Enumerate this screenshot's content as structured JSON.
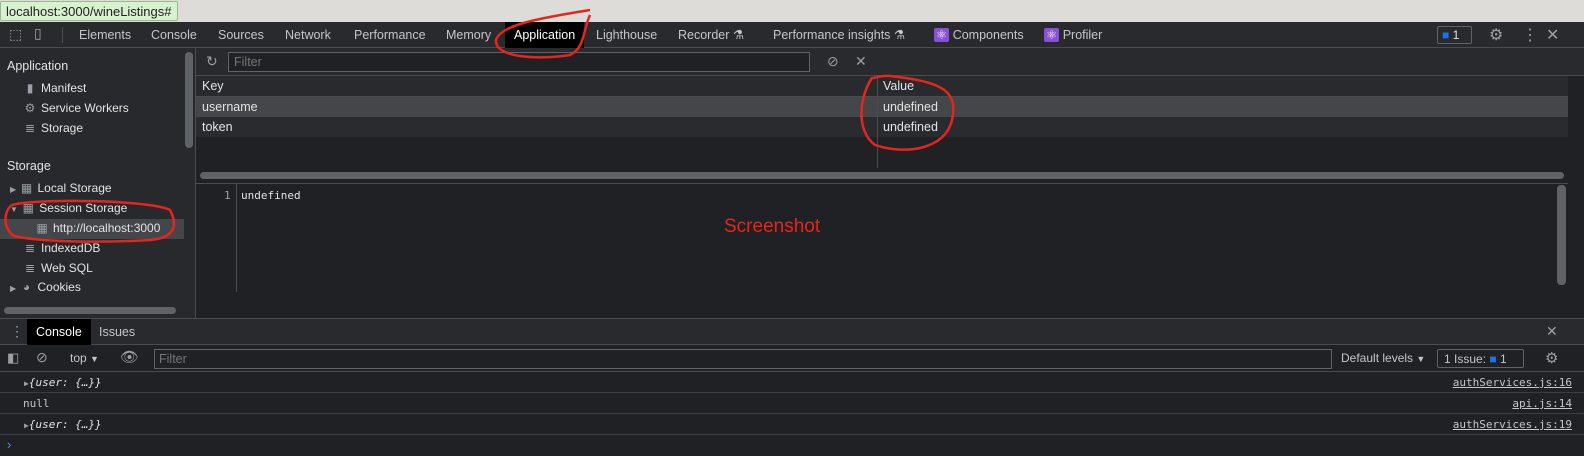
{
  "browser": {
    "status_url": "localhost:3000/wineListings#"
  },
  "devtools": {
    "tabs": [
      "Elements",
      "Console",
      "Sources",
      "Network",
      "Performance",
      "Memory",
      "Application",
      "Lighthouse",
      "Recorder",
      "Performance insights",
      "Components",
      "Profiler"
    ],
    "active_tab": "Application",
    "issues_count": "1"
  },
  "sidebar": {
    "application_header": "Application",
    "application_items": [
      "Manifest",
      "Service Workers",
      "Storage"
    ],
    "storage_header": "Storage",
    "storage_items": [
      "Local Storage",
      "Session Storage",
      "http://localhost:3000",
      "IndexedDB",
      "Web SQL",
      "Cookies"
    ]
  },
  "storage_view": {
    "filter_placeholder": "Filter",
    "columns": [
      "Key",
      "Value"
    ],
    "rows": [
      {
        "key": "username",
        "value": "undefined"
      },
      {
        "key": "token",
        "value": "undefined"
      }
    ],
    "preview_line_number": "1",
    "preview_value": "undefined"
  },
  "annotation": {
    "label": "Screenshot",
    "color": "#e5261c"
  },
  "drawer": {
    "tabs": [
      "Console",
      "Issues"
    ],
    "context": "top",
    "filter_placeholder": "Filter",
    "levels": "Default levels",
    "issues_label": "1 Issue:",
    "issues_count": "1",
    "messages": [
      {
        "text": "{user: {…}}",
        "source": "authServices.js:16"
      },
      {
        "text": "null",
        "source": "api.js:14"
      },
      {
        "text": "{user: {…}}",
        "source": "authServices.js:19"
      }
    ]
  }
}
